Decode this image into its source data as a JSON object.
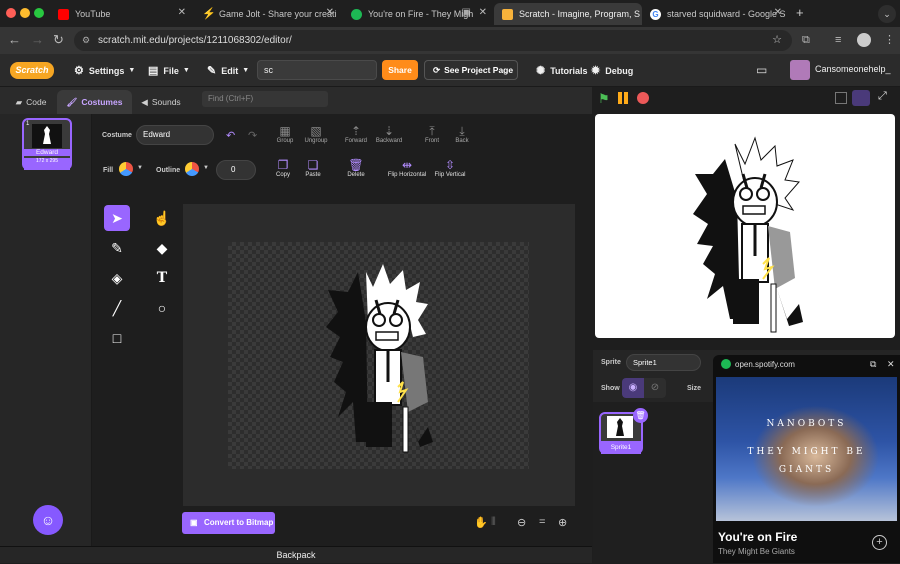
{
  "browser": {
    "tabs": [
      {
        "title": "YouTube",
        "favicon_color": "#ff0000"
      },
      {
        "title": "Game Jolt - Share your creati",
        "favicon_color": "#ccff00"
      },
      {
        "title": "You're on Fire - They Migh",
        "favicon_color": "#1db954"
      },
      {
        "title": "Scratch - Imagine, Program, S",
        "favicon_color": "#f7b23b"
      },
      {
        "title": "starved squidward - Google S",
        "favicon_color": "#4285f4"
      }
    ],
    "url": "scratch.mit.edu/projects/1211068302/editor/"
  },
  "menubar": {
    "logo": "Scratch",
    "settings": "Settings",
    "file": "File",
    "edit": "Edit",
    "project_title": "sc",
    "share": "Share",
    "see_project_page": "See Project Page",
    "tutorials": "Tutorials",
    "debug": "Debug",
    "username": "Cansomeonehelp_"
  },
  "editor_tabs": {
    "code": "Code",
    "costumes": "Costumes",
    "sounds": "Sounds",
    "find_placeholder": "Find (Ctrl+F)"
  },
  "costume_list": {
    "items": [
      {
        "number": "1",
        "name": "Edward",
        "size": "172 x 295"
      }
    ]
  },
  "paint_editor": {
    "costume_label": "Costume",
    "costume_name": "Edward",
    "fill_label": "Fill",
    "outline_label": "Outline",
    "outline_width": "0",
    "buttons": {
      "group": "Group",
      "ungroup": "Ungroup",
      "forward": "Forward",
      "backward": "Backward",
      "front": "Front",
      "back": "Back",
      "copy": "Copy",
      "paste": "Paste",
      "delete": "Delete",
      "flip_horizontal": "Flip Horizontal",
      "flip_vertical": "Flip Vertical"
    },
    "convert_button": "Convert to Bitmap"
  },
  "backpack": "Backpack",
  "sprite_info": {
    "sprite_label": "Sprite",
    "sprite_name": "Sprite1",
    "show_label": "Show",
    "size_label": "Size"
  },
  "sprites": [
    {
      "name": "Sprite1"
    }
  ],
  "spotify": {
    "domain": "open.spotify.com",
    "album_line1": "NANOBOTS",
    "album_line2": "THEY MIGHT BE",
    "album_line3": "GIANTS",
    "song_title": "You're on Fire",
    "artist": "They Might Be Giants"
  },
  "colors": {
    "accent": "#9966ff",
    "share": "#ff8c1a",
    "stage_bg": "#ffffff"
  }
}
